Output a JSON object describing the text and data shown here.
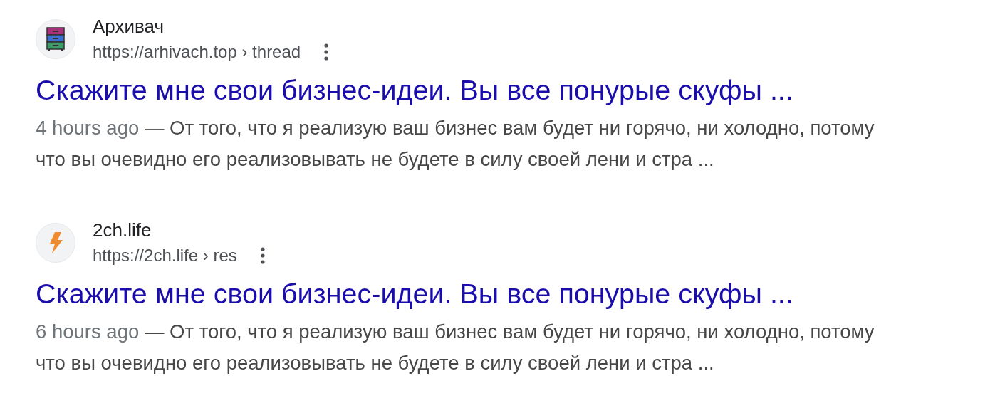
{
  "results": [
    {
      "favicon": {
        "kind": "drawers"
      },
      "site_name": "Архивач",
      "url": "https://arhivach.top › thread",
      "title": "Скажите мне свои бизнес-идеи. Вы все понурые скуфы ...",
      "date": "4 hours ago",
      "snippet": "— От того, что я реализую ваш бизнес вам будет ни горячо, ни холодно, потому что вы очевидно его реализовывать не будете в силу своей лени и стра ..."
    },
    {
      "favicon": {
        "kind": "bolt"
      },
      "site_name": "2ch.life",
      "url": "https://2ch.life › res",
      "title": "Скажите мне свои бизнес-идеи. Вы все понурые скуфы ...",
      "date": "6 hours ago",
      "snippet": "— От того, что я реализую ваш бизнес вам будет ни горячо, ни холодно, потому что вы очевидно его реализовывать не будете в силу своей лени и стра ..."
    }
  ]
}
